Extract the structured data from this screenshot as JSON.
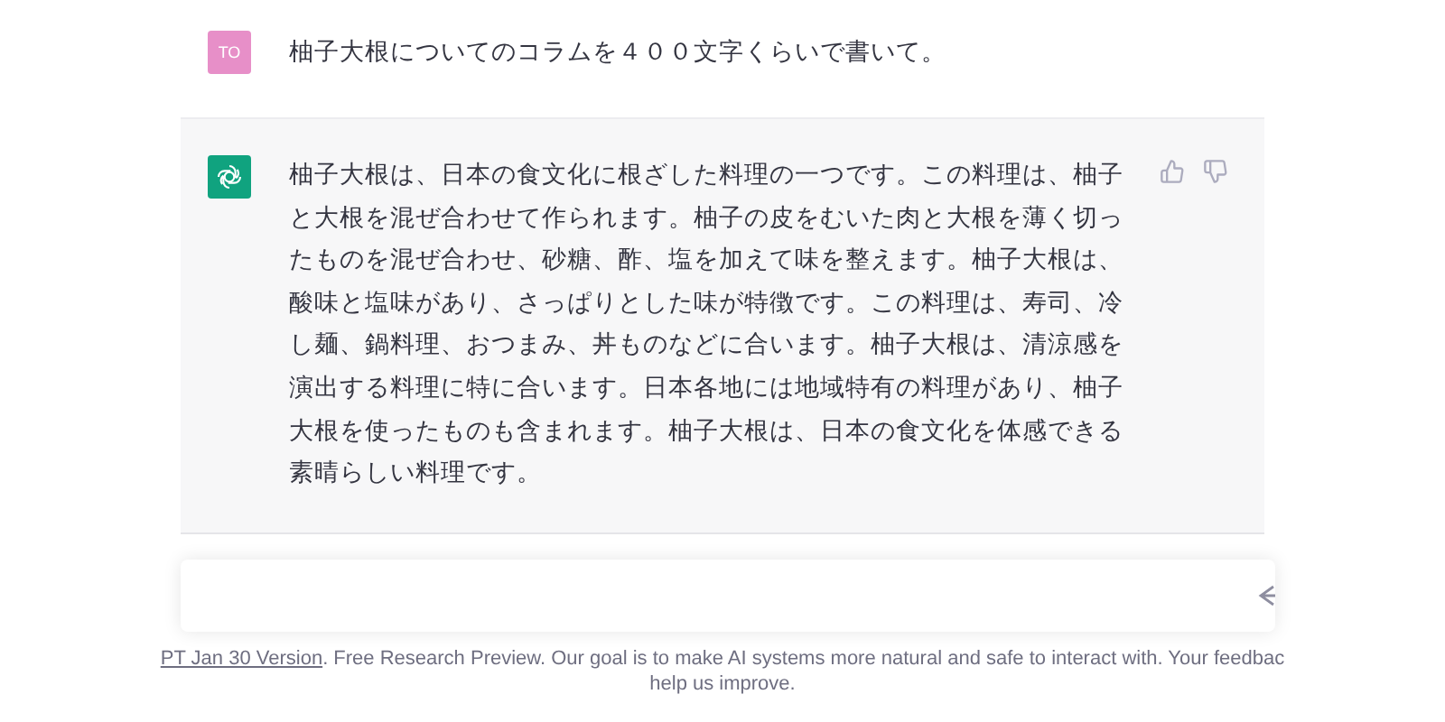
{
  "messages": [
    {
      "kind": "user",
      "avatar": "TO",
      "text": "柚子大根についてのコラムを４００文字くらいで書いて。"
    },
    {
      "kind": "assistant",
      "text": "柚子大根は、日本の食文化に根ざした料理の一つです。この料理は、柚子と大根を混ぜ合わせて作られます。柚子の皮をむいた肉と大根を薄く切ったものを混ぜ合わせ、砂糖、酢、塩を加えて味を整えます。柚子大根は、酸味と塩味があり、さっぱりとした味が特徴です。この料理は、寿司、冷し麺、鍋料理、おつまみ、丼ものなどに合います。柚子大根は、清涼感を演出する料理に特に合います。日本各地には地域特有の料理があり、柚子大根を使ったものも含まれます。柚子大根は、日本の食文化を体感できる素晴らしい料理です。"
    }
  ],
  "footer": {
    "link": "PT Jan 30 Version",
    "text": ". Free Research Preview. Our goal is to make AI systems more natural and safe to interact with. Your feedbac",
    "text_line_2": "help us improve."
  }
}
